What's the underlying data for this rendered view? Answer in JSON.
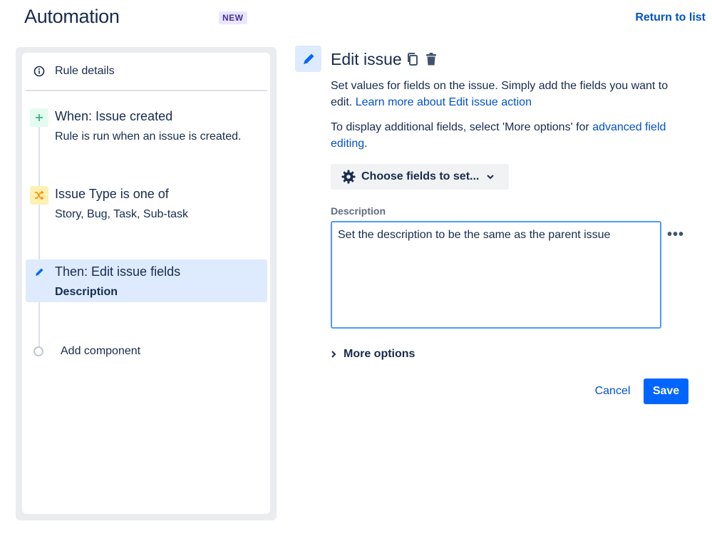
{
  "header": {
    "title": "Automation",
    "badge": "NEW",
    "return_link": "Return to list"
  },
  "sidebar": {
    "rule_details": {
      "label": "Rule details",
      "icon": "info-icon"
    },
    "components": [
      {
        "title": "When: Issue created",
        "subtitle": "Rule is run when an issue is created.",
        "icon": "plus-icon",
        "icon_color": "#36B37E",
        "icon_bg": "#E3FCEF"
      },
      {
        "title": "Issue Type is one of",
        "subtitle": "Story, Bug, Task, Sub-task",
        "icon": "shuffle-icon",
        "icon_color": "#FF8B00",
        "icon_bg": "#FFF0B3"
      },
      {
        "title": "Then: Edit issue fields",
        "subtitle": "Description",
        "icon": "pencil-icon",
        "icon_color": "#0065FF",
        "icon_bg": "#DEEBFF",
        "active": true
      }
    ],
    "add_component": "Add component"
  },
  "editor": {
    "title": "Edit issue",
    "intro": "Set values for fields on the issue. Simply add the fields you want to edit.",
    "intro_link": "Learn more about Edit issue action",
    "more_text": "To display additional fields, select 'More options' for",
    "more_link": "advanced field editing",
    "more_end": ".",
    "choose_fields": "Choose fields to set...",
    "field_label": "Description",
    "field_value": "Set the description to be the same as the parent issue",
    "more_options": "More options",
    "cancel": "Cancel",
    "save": "Save"
  },
  "colors": {
    "accent": "#0052CC",
    "primary_button": "#0065FF",
    "focus_border": "#4C9AFF"
  }
}
